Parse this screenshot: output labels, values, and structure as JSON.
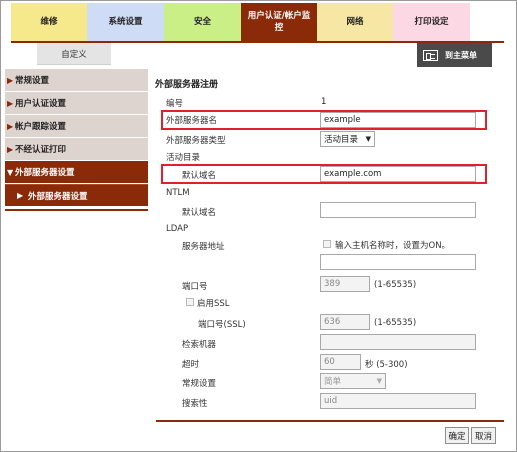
{
  "tabs": [
    {
      "label": "维修",
      "color": "#f5e98b"
    },
    {
      "label": "系统设置",
      "color": "#cfdcf5"
    },
    {
      "label": "安全",
      "color": "#c9ef86"
    },
    {
      "label": "用户认证/帐户监控",
      "color": "#8b2a09"
    },
    {
      "label": "网络",
      "color": "#f6e8a4"
    },
    {
      "label": "打印设定",
      "color": "#fcd7e4"
    }
  ],
  "subtab": "自定义",
  "menu_button": "到主菜单",
  "sidebar": {
    "items": [
      "常规设置",
      "用户认证设置",
      "帐户跟踪设置",
      "不经认证打印",
      "外部服务器设置"
    ],
    "subitem": "外部服务器设置"
  },
  "form": {
    "title": "外部服务器注册",
    "number_label": "编号",
    "number_value": "1",
    "server_name_label": "外部服务器名",
    "server_name_value": "example",
    "server_type_label": "外部服务器类型",
    "server_type_value": "活动目录",
    "ad_section": "活动目录",
    "ad_domain_label": "默认域名",
    "ad_domain_value": "example.com",
    "ntlm_section": "NTLM",
    "ntlm_domain_label": "默认域名",
    "ntlm_domain_value": "",
    "ldap_section": "LDAP",
    "server_addr_label": "服务器地址",
    "server_addr_checkbox": "输入主机名称时，设置为ON。",
    "server_addr_value": "",
    "port_label": "端口号",
    "port_value": "389",
    "port_range": "(1-65535)",
    "ssl_label": "启用SSL",
    "ssl_port_label": "端口号(SSL)",
    "ssl_port_value": "636",
    "ssl_port_range": "(1-65535)",
    "search_base_label": "检索机器",
    "search_base_value": "",
    "timeout_label": "超时",
    "timeout_value": "60",
    "timeout_range": "秒 (5-300)",
    "general_label": "常规设置",
    "general_value": "简单",
    "search_attr_label": "搜索性",
    "search_attr_value": "uid"
  },
  "buttons": {
    "ok": "确定",
    "cancel": "取消"
  },
  "colors": {
    "accent": "#8b2a09",
    "highlight": "#e0212b"
  }
}
